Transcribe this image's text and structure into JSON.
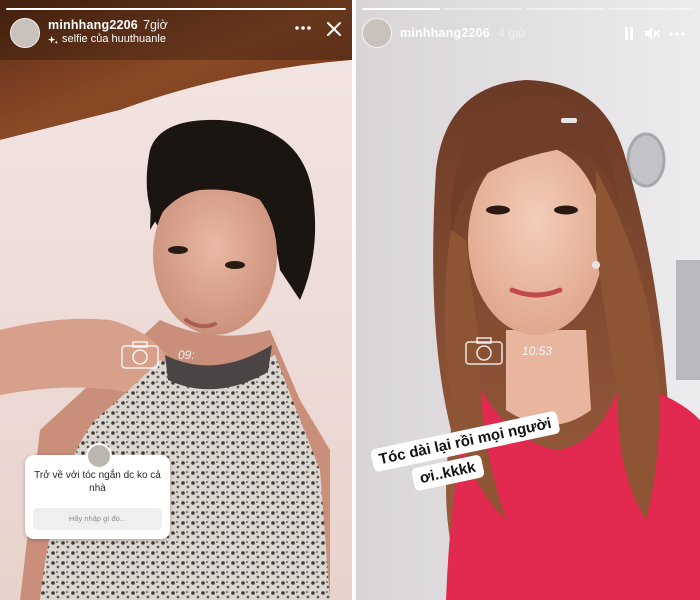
{
  "left_story": {
    "username": "minhhang2206",
    "time": "7giờ",
    "subtitle": "selfie của huuthuanle",
    "photo_stamp": "09:",
    "question_sticker": {
      "question": "Trở về với tóc ngắn dc ko cả nhà",
      "input_placeholder": "Hãy nhập gì đó..."
    },
    "progress_segments": 1,
    "active_segment": 0
  },
  "right_story": {
    "username": "minhhang2206",
    "time": "4 giờ",
    "photo_stamp": "10:53",
    "caption_line1": "Tóc dài lại rồi mọi người",
    "caption_line2": "ơi..kkkk",
    "progress_segments": 4,
    "active_segment": 0
  },
  "colors": {
    "progress_active": "#ffffff",
    "progress_inactive": "rgba(255,255,255,0.45)"
  }
}
